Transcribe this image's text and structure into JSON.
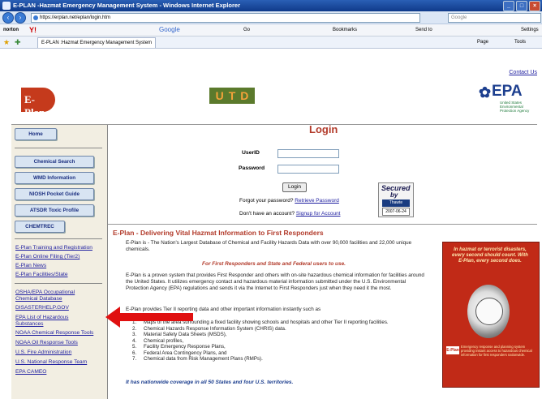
{
  "browser": {
    "title": "E-PLAN -Hazmat Emergency Management System - Windows Internet Explorer",
    "address": "https://erplan.net/eplan/login.htm",
    "search_placeholder": "Google",
    "toolbar": {
      "google_label": "Google",
      "go_label": "Go",
      "bookmarks_label": "Bookmarks",
      "sendto_label": "Send to",
      "settings_label": "Settings",
      "page_label": "Page",
      "tools_label": "Tools"
    },
    "tab_label": "E-PLAN :Hazmat Emergency Management System"
  },
  "header": {
    "contact_link": "Contact Us",
    "eplan_logo": "E-Plan",
    "utd_letters": [
      "U",
      "T",
      "D"
    ],
    "epa_logo": "EPA",
    "epa_subtitle": "United States Environmental Protection Agency"
  },
  "sidebar": {
    "buttons": [
      {
        "label": "Home"
      },
      {
        "label": "Chemical Search"
      },
      {
        "label": "WMD Information"
      },
      {
        "label": "NIOSH Pocket Guide"
      },
      {
        "label": "ATSDR Toxic Profile"
      },
      {
        "label": "CHEMTREC"
      }
    ],
    "links_group1": [
      {
        "label": "E-Plan Training and Registration"
      },
      {
        "label": "E-Plan Online Filing (Tier2)"
      },
      {
        "label": "E-Plan News"
      },
      {
        "label": "E-Plan Facilities/State"
      }
    ],
    "links_group2": [
      {
        "label": "OSHA/EPA Occupational Chemical Database"
      },
      {
        "label": "DISASTERHELP.GOV"
      },
      {
        "label": "EPA List of Hazardous Substances"
      },
      {
        "label": "NOAA Chemical Response Tools"
      },
      {
        "label": "NOAA Oil Response Tools"
      },
      {
        "label": "U.S. Fire Administration"
      },
      {
        "label": "U.S. National Response Team"
      },
      {
        "label": "EPA CAMEO"
      }
    ]
  },
  "login": {
    "title": "Login",
    "userid_label": "UserID",
    "password_label": "Password",
    "login_button": "Login",
    "forgot_text": "Forgot your password?",
    "forgot_link": "Retrieve Password",
    "no_account_text": "Don't have an account?",
    "signup_link": "Signup for Account",
    "secured_line1": "Secured",
    "secured_line2": "by",
    "secured_brand": "Thawte",
    "secured_date": "2007-06-24"
  },
  "content": {
    "heading": "E-Plan - Delivering Vital Hazmat Information to First Responders",
    "para1": "E-Plan is - The Nation's Largest Database of Chemical and Facility Hazards Data with over 90,000 facilities and 22,000 unique chemicals.",
    "para2_red": "For First Responders and State and Federal users to use.",
    "para3": "E-Plan is a proven system that provides First Responder and others with on-site hazardous chemical information for facilities around the United States. It utilizes emergency contact and hazardous material information submitted under the U.S. Environmental Protection Agency (EPA) regulations and sends it via the Internet to First Responders just when they need it the most.",
    "para4": "E-Plan provides Tier II reporting data and other important information instantly such as",
    "list": [
      {
        "n": "1.",
        "text": "Maps of the area surrounding a fixed facility showing schools and hospitals and other Tier II reporting facilities."
      },
      {
        "n": "2.",
        "text": "Chemical Hazards Response Information System (CHRIS) data."
      },
      {
        "n": "3.",
        "text": "Material Safety Data Sheets (MSDS),"
      },
      {
        "n": "4.",
        "text": "Chemical profiles,"
      },
      {
        "n": "5.",
        "text": "Facility Emergency Response Plans,"
      },
      {
        "n": "6.",
        "text": "Federal Area Contingency Plans, and"
      },
      {
        "n": "7.",
        "text": "Chemical data from Risk Management Plans (RMPs)."
      }
    ],
    "footer_red": "It has nationwide coverage in all 50 States and four U.S. territories."
  },
  "poster": {
    "text": "In hazmat or terrorist disasters, every second should count. With E-Plan, every second does.",
    "logo": "E-Plan",
    "body": "Emergency response and planning system providing instant access to hazardous chemical information for first responders nationwide."
  },
  "colors": {
    "accent_red": "#b23a2a",
    "link_blue": "#1e1ea0",
    "sidebar_bg": "#f2eee2",
    "arrow_red": "#e01010"
  }
}
